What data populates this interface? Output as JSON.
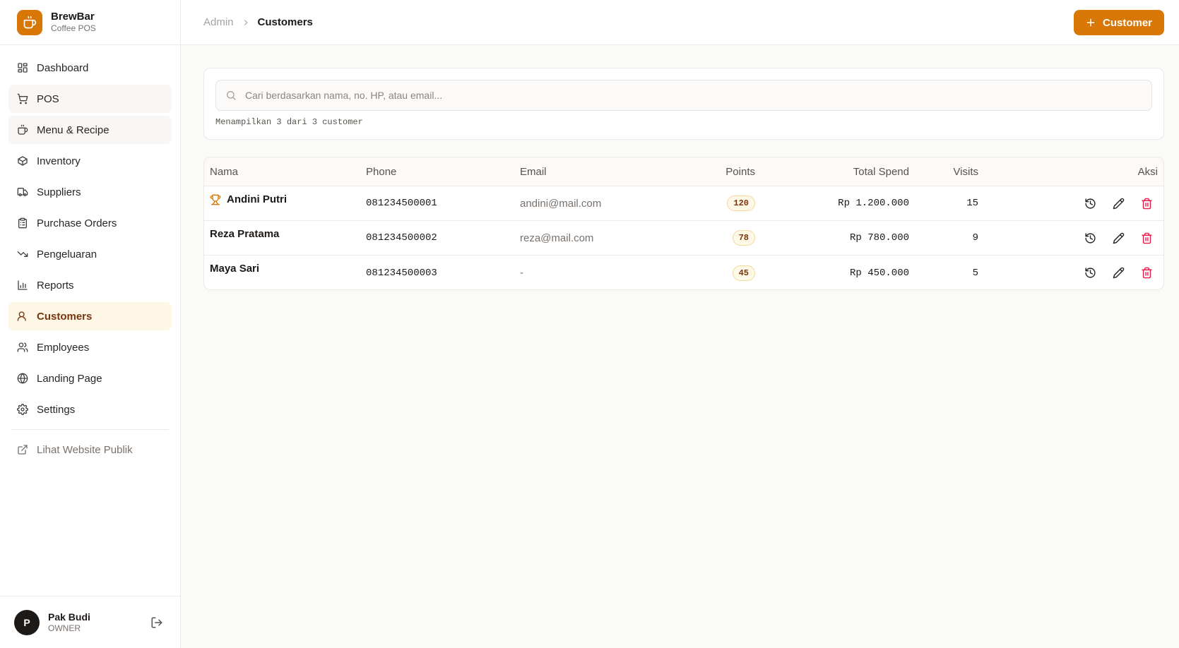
{
  "brand": {
    "name": "BrewBar",
    "subtitle": "Coffee POS",
    "accent": "#d97706"
  },
  "sidebar": {
    "items": [
      {
        "label": "Dashboard",
        "icon": "dashboard-icon"
      },
      {
        "label": "POS",
        "icon": "cart-icon"
      },
      {
        "label": "Menu & Recipe",
        "icon": "coffee-icon"
      },
      {
        "label": "Inventory",
        "icon": "package-icon"
      },
      {
        "label": "Suppliers",
        "icon": "truck-icon"
      },
      {
        "label": "Purchase Orders",
        "icon": "clipboard-icon"
      },
      {
        "label": "Pengeluaran",
        "icon": "trending-down-icon"
      },
      {
        "label": "Reports",
        "icon": "bar-chart-icon"
      },
      {
        "label": "Customers",
        "icon": "users-icon",
        "active": true
      },
      {
        "label": "Employees",
        "icon": "user-group-icon"
      },
      {
        "label": "Landing Page",
        "icon": "globe-icon"
      },
      {
        "label": "Settings",
        "icon": "gear-icon"
      }
    ],
    "external_link": {
      "label": "Lihat Website Publik",
      "icon": "external-link-icon"
    }
  },
  "user": {
    "initial": "P",
    "name": "Pak Budi",
    "role": "OWNER"
  },
  "header": {
    "breadcrumb_root": "Admin",
    "breadcrumb_current": "Customers",
    "add_button_label": "Customer"
  },
  "search": {
    "placeholder": "Cari berdasarkan nama, no. HP, atau email...",
    "value": "",
    "count_text": "Menampilkan 3 dari 3 customer"
  },
  "table": {
    "columns": {
      "name": "Nama",
      "phone": "Phone",
      "email": "Email",
      "points": "Points",
      "spend": "Total Spend",
      "visits": "Visits",
      "actions": "Aksi"
    },
    "rows": [
      {
        "name": "Andini Putri",
        "top": true,
        "phone": "081234500001",
        "email": "andini@mail.com",
        "points": "120",
        "spend": "Rp 1.200.000",
        "visits": "15"
      },
      {
        "name": "Reza Pratama",
        "top": false,
        "phone": "081234500002",
        "email": "reza@mail.com",
        "points": "78",
        "spend": "Rp 780.000",
        "visits": "9"
      },
      {
        "name": "Maya Sari",
        "top": false,
        "phone": "081234500003",
        "email": "-",
        "points": "45",
        "spend": "Rp 450.000",
        "visits": "5"
      }
    ]
  },
  "colors": {
    "danger": "#e11d48",
    "active_bg": "#fef7e6",
    "badge_bg": "#fef9e7"
  }
}
